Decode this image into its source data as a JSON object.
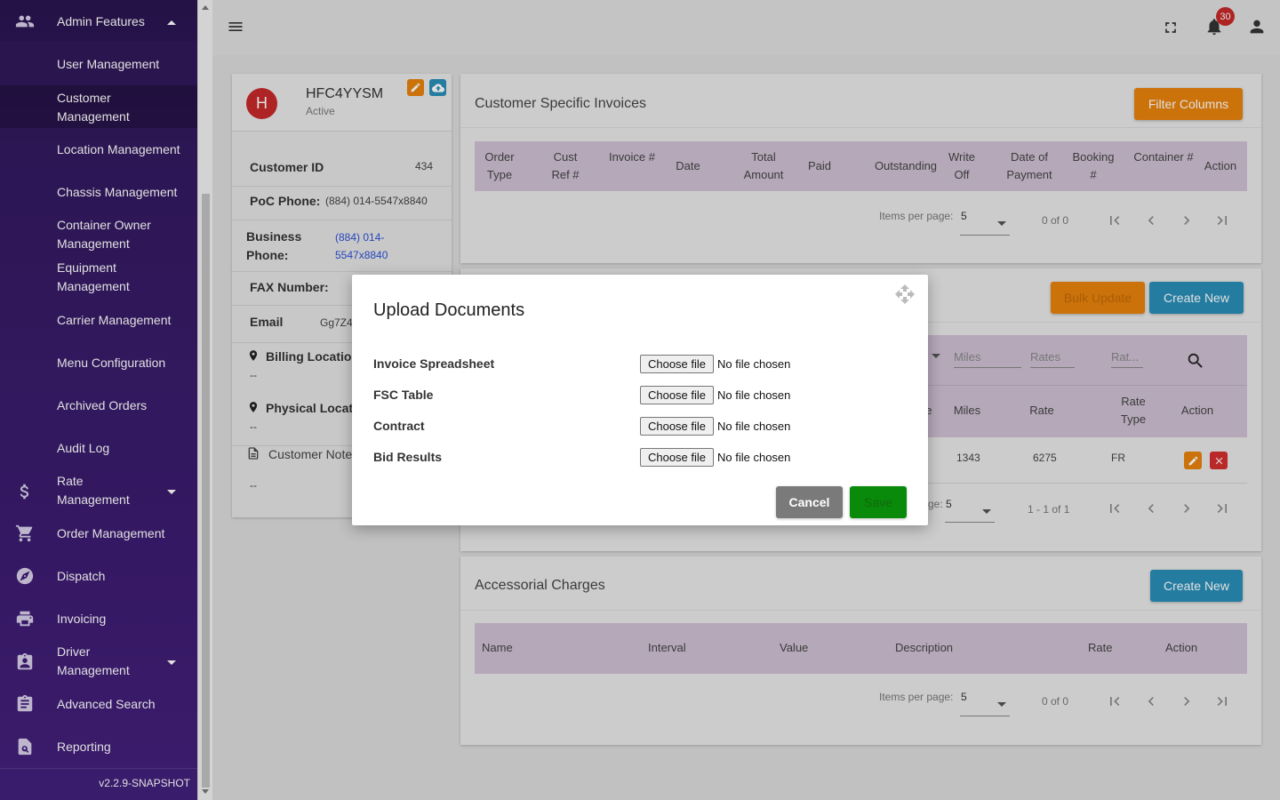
{
  "sidebar": {
    "admin": {
      "label": "Admin Features",
      "icon": "people-icon"
    },
    "sub_items": [
      {
        "label": "User Management"
      },
      {
        "label": "Customer Management"
      },
      {
        "label": "Location Management"
      },
      {
        "label": "Chassis Management"
      },
      {
        "label": "Container Owner Management"
      },
      {
        "label": "Equipment Management"
      },
      {
        "label": "Carrier Management"
      },
      {
        "label": "Menu Configuration"
      },
      {
        "label": "Archived Orders"
      },
      {
        "label": "Audit Log"
      }
    ],
    "items": [
      {
        "label": "Rate Management",
        "icon": "dollar-icon"
      },
      {
        "label": "Order Management",
        "icon": "cart-icon"
      },
      {
        "label": "Dispatch",
        "icon": "compass-icon"
      },
      {
        "label": "Invoicing",
        "icon": "printer-icon"
      },
      {
        "label": "Driver Management",
        "icon": "badge-icon"
      },
      {
        "label": "Advanced Search",
        "icon": "clipboard-icon"
      },
      {
        "label": "Reporting",
        "icon": "report-search-icon"
      }
    ],
    "version": "v2.2.9-SNAPSHOT"
  },
  "header": {
    "notification_count": "30"
  },
  "customer": {
    "avatar_letter": "H",
    "name": "HFC4YYSM",
    "status": "Active",
    "customer_id_label": "Customer ID",
    "customer_id": "434",
    "poc_phone_label": "PoC Phone:",
    "poc_phone": "(884) 014-5547x8840",
    "business_phone_label": "Business Phone:",
    "business_phone": "(884) 014-5547x8840",
    "fax_label": "FAX Number:",
    "email_label": "Email",
    "email": "Gg7Z4",
    "billing_label": "Billing Location",
    "billing_value": "--",
    "physical_label": "Physical Location",
    "physical_value": "--",
    "notes_label": "Customer Notes",
    "notes_value": "--"
  },
  "invoices": {
    "title": "Customer Specific Invoices",
    "filter_button": "Filter Columns",
    "columns": [
      "Order Type",
      "Cust Ref #",
      "Invoice #",
      "Date",
      "Total Amount",
      "Paid",
      "Outstanding",
      "Write Off",
      "Date of Payment",
      "Booking #",
      "Container #",
      "Action"
    ],
    "items_per_page_label": "Items per page:",
    "items_per_page": "5",
    "range": "0 of 0"
  },
  "rates": {
    "bulk_update": "Bulk Update",
    "create_new": "Create New",
    "filters": [
      "Miles",
      "Rates",
      "Rat..."
    ],
    "columns": [
      "e",
      "Miles",
      "Rate",
      "Rate Type",
      "Action"
    ],
    "row": {
      "miles": "1343",
      "rate": "6275",
      "rate_type": "FR"
    },
    "items_per_page_label": "ge:",
    "items_per_page": "5",
    "range": "1 - 1 of 1"
  },
  "accessorial": {
    "title": "Accessorial Charges",
    "create_new": "Create New",
    "columns": [
      "Name",
      "Interval",
      "Value",
      "Description",
      "Rate",
      "Action"
    ],
    "items_per_page_label": "Items per page:",
    "items_per_page": "5",
    "range": "0 of 0"
  },
  "modal": {
    "title": "Upload Documents",
    "fields": [
      {
        "label": "Invoice Spreadsheet",
        "button": "Choose file",
        "status": "No file chosen"
      },
      {
        "label": "FSC Table",
        "button": "Choose file",
        "status": "No file chosen"
      },
      {
        "label": "Contract",
        "button": "Choose file",
        "status": "No file chosen"
      },
      {
        "label": "Bid Results",
        "button": "Choose file",
        "status": "No file chosen"
      }
    ],
    "cancel": "Cancel",
    "save": "Save"
  },
  "colors": {
    "sidebar": "#351a63",
    "accent_orange": "#e8820c",
    "accent_blue": "#2a8fb8",
    "table_head": "#cfc0d3",
    "save_green": "#0a8a0a",
    "cancel_gray": "#7a7a7a",
    "avatar_red": "#c62828"
  }
}
